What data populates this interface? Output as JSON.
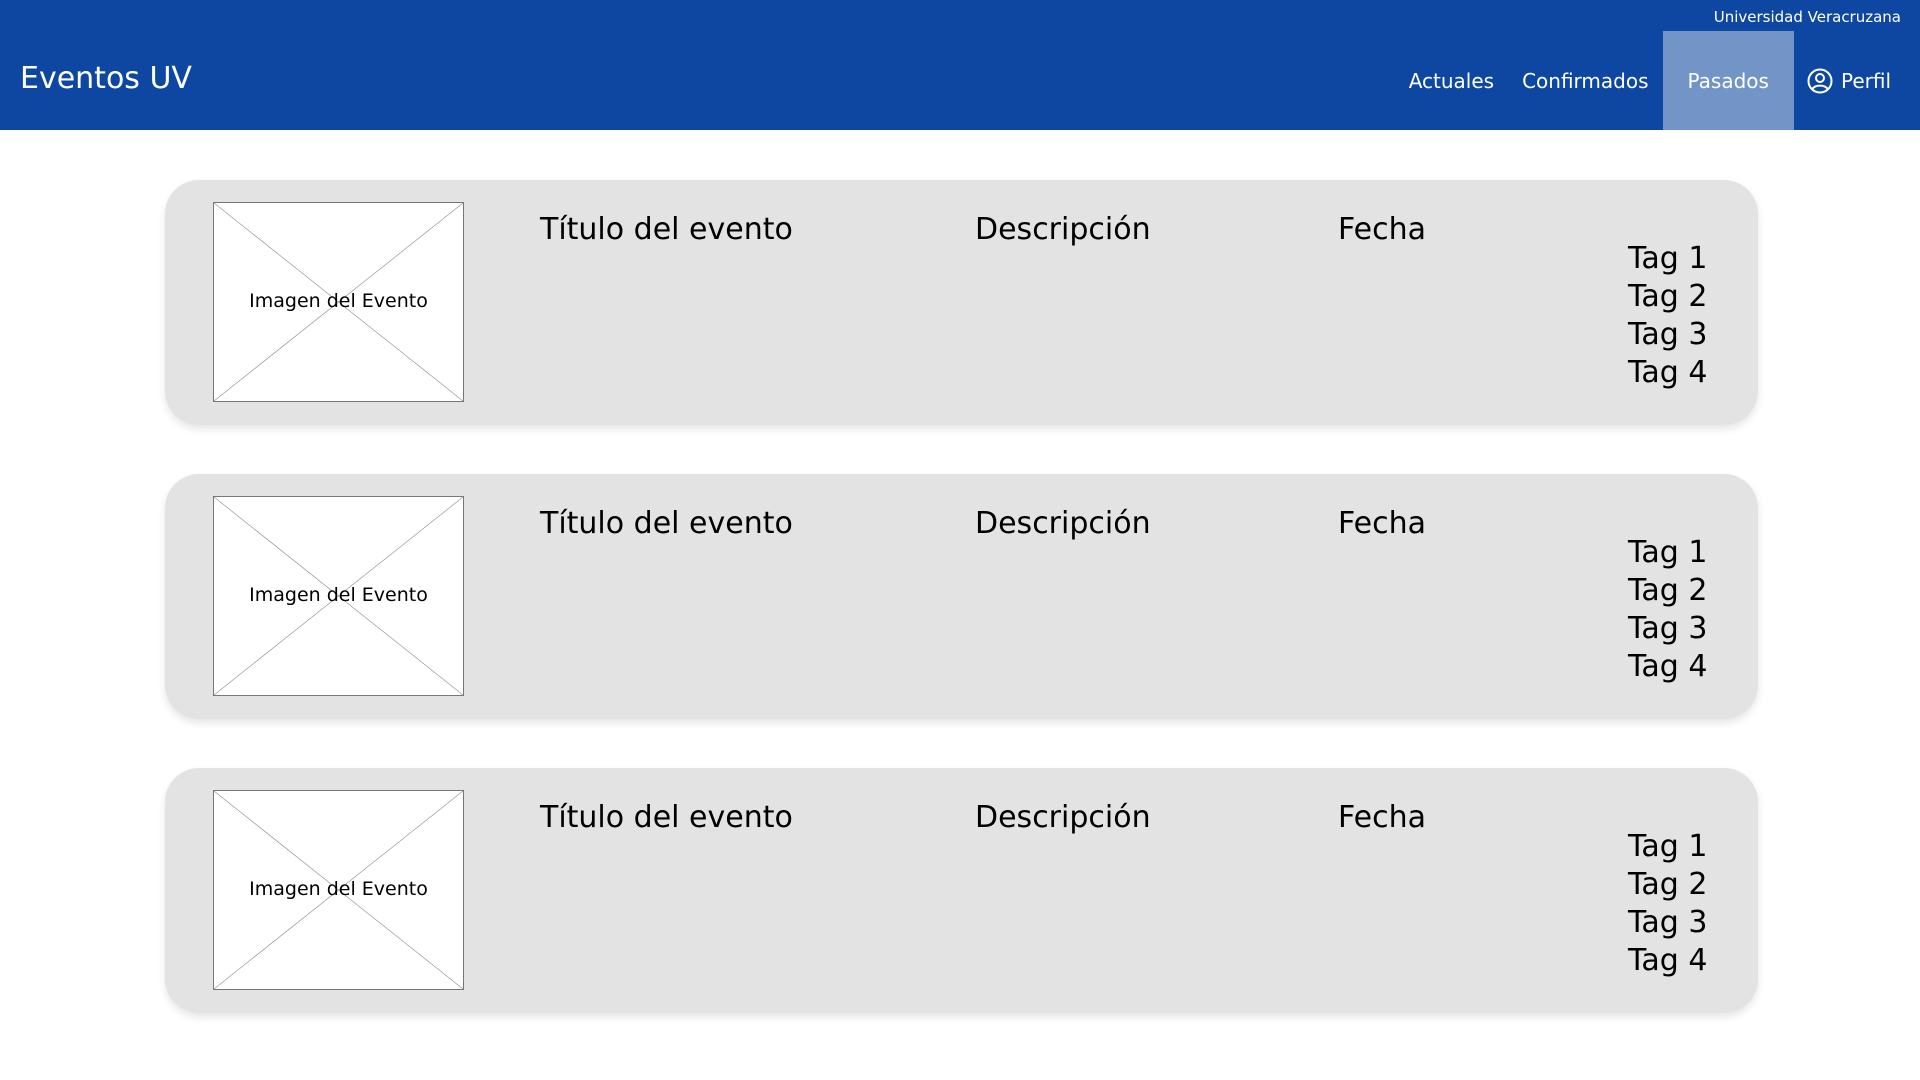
{
  "header": {
    "org_name": "Universidad Veracruzana",
    "brand": "Eventos UV",
    "nav": [
      {
        "label": "Actuales",
        "active": false
      },
      {
        "label": "Confirmados",
        "active": false
      },
      {
        "label": "Pasados",
        "active": true
      },
      {
        "label": "Perfil",
        "icon": "user-circle-icon",
        "active": false
      }
    ],
    "colors": {
      "header_bg": "#0E47A1",
      "active_tab_bg": "#7294C7",
      "card_bg": "#E3E3E3"
    }
  },
  "events": [
    {
      "image_label": "Imagen del Evento",
      "title": "Título del evento",
      "description": "Descripción",
      "date": "Fecha",
      "tags": [
        "Tag 1",
        "Tag 2",
        "Tag 3",
        "Tag 4"
      ]
    },
    {
      "image_label": "Imagen del Evento",
      "title": "Título del evento",
      "description": "Descripción",
      "date": "Fecha",
      "tags": [
        "Tag 1",
        "Tag 2",
        "Tag 3",
        "Tag 4"
      ]
    },
    {
      "image_label": "Imagen del Evento",
      "title": "Título del evento",
      "description": "Descripción",
      "date": "Fecha",
      "tags": [
        "Tag 1",
        "Tag 2",
        "Tag 3",
        "Tag 4"
      ]
    }
  ]
}
